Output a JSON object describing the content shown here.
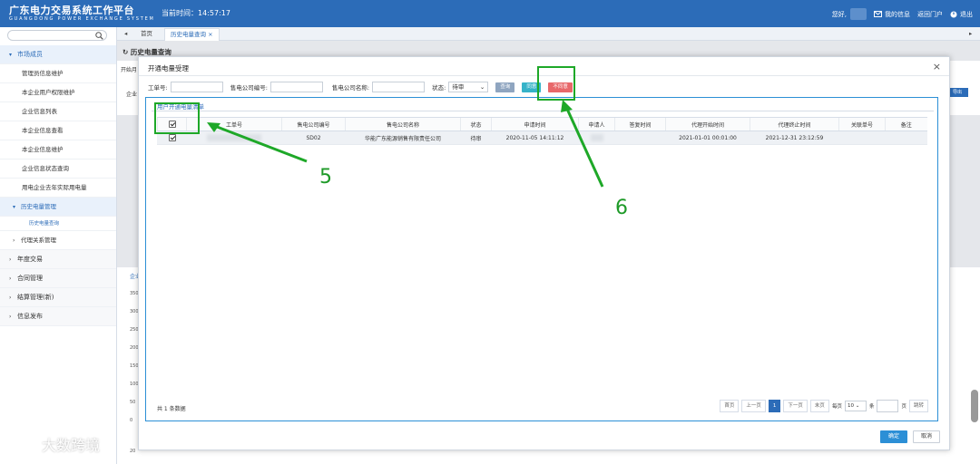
{
  "header": {
    "title": "广东电力交易系统工作平台",
    "subtitle": "GUANGDONG POWER EXCHANGE SYSTEM",
    "time_label": "当前时间：",
    "time": "14:57:17",
    "greeting": "您好,",
    "my_info": "我的信息",
    "return_portal": "返回门户",
    "logout": "退出"
  },
  "sidebar": {
    "search_placeholder": "",
    "items": [
      {
        "label": "市场成员"
      },
      {
        "label": "管理员信息维护"
      },
      {
        "label": "本企业用户权限维护"
      },
      {
        "label": "企业信息列表"
      },
      {
        "label": "本企业信息查看"
      },
      {
        "label": "本企业信息维护"
      },
      {
        "label": "企业信息状态查询"
      },
      {
        "label": "用电企业去年实际用电量"
      },
      {
        "label": "历史电量管理"
      },
      {
        "label": "历史电量查询"
      },
      {
        "label": "代理关系管理"
      },
      {
        "label": "年度交易"
      },
      {
        "label": "合同管理"
      },
      {
        "label": "结算管理(新)"
      },
      {
        "label": "信息发布"
      }
    ]
  },
  "tabs": {
    "home": "首页",
    "history_query": "历史电量查询"
  },
  "page": {
    "title": "历史电量查询",
    "bg_label_1": "开始月",
    "bg_label_2": "企业",
    "bg_label_3": "企业",
    "bg_export": "导出",
    "bg_axis": [
      "350",
      "300",
      "250",
      "200",
      "150",
      "100",
      "50",
      "0"
    ],
    "bg_footer": "20"
  },
  "modal": {
    "title": "开通电量受理",
    "close": "×",
    "filters": {
      "work_order_label": "工单号:",
      "seller_code_label": "售电公司编号:",
      "seller_name_label": "售电公司名称:",
      "status_label": "状态:",
      "status_value": "待审",
      "query_btn": "查询",
      "agree_btn": "同意",
      "disagree_btn": "不同意"
    },
    "list_title": "用户开通电量清单",
    "columns": [
      "工单号",
      "售电公司编号",
      "售电公司名称",
      "状态",
      "申请时间",
      "申请人",
      "答复时间",
      "代理开始时间",
      "代理终止时间",
      "关联单号",
      "备注"
    ],
    "rows": [
      {
        "work_order": "",
        "seller_code": "SD02",
        "seller_name": "华能广东能源销售有限责任公司",
        "status": "待审",
        "apply_time": "2020-11-05 14:11:12",
        "applicant": "",
        "reply_time": "",
        "proxy_start": "2021-01-01 00:01:00",
        "proxy_end": "2021-12-31 23:12:59",
        "related_no": "",
        "remark": ""
      }
    ],
    "total": "共 1 条数据",
    "pager": {
      "first": "首页",
      "prev": "上一页",
      "page": "1",
      "next": "下一页",
      "last": "末页",
      "per_page_label": "每页",
      "per_page": "10",
      "unit": "条",
      "page_unit": "页",
      "jump": "跳转"
    },
    "confirm": "确定",
    "cancel": "取消"
  },
  "annotations": {
    "step5": "5",
    "step6": "6",
    "color": "#1ea828"
  },
  "watermark": "大数跨境",
  "colors": {
    "header_bg": "#2c6cb8",
    "agree": "#36b3c9",
    "disagree": "#e8686a",
    "confirm": "#2c8fd6"
  }
}
